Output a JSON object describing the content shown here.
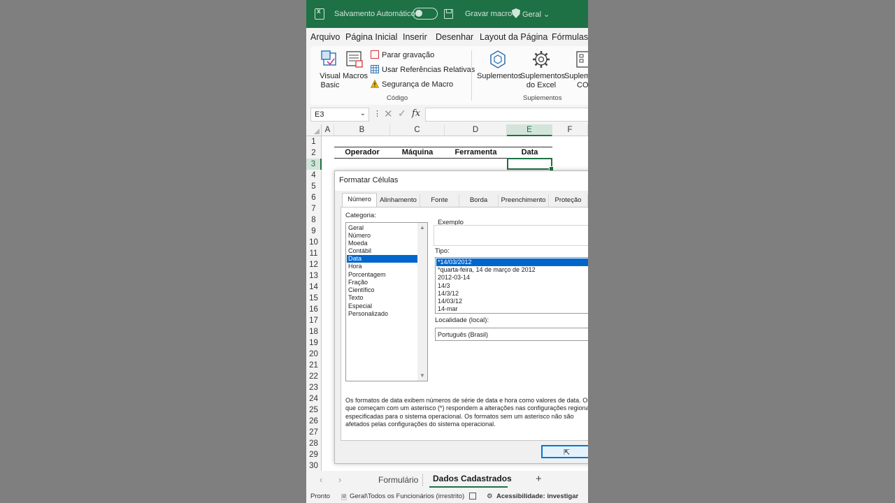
{
  "titlebar": {
    "autosave_label": "Salvamento Automático",
    "record_macro": "Gravar macro",
    "sensitivity": "Geral"
  },
  "ribbon_tabs": [
    "Arquivo",
    "Página Inicial",
    "Inserir",
    "Desenhar",
    "Layout da Página",
    "Fórmulas"
  ],
  "ribbon": {
    "visual_basic_1": "Visual",
    "visual_basic_2": "Basic",
    "macros": "Macros",
    "stop_recording": "Parar gravação",
    "relative_refs": "Usar Referências Relativas",
    "macro_security": "Segurança de Macro",
    "group_code": "Código",
    "addins": "Suplementos",
    "excel_addins_1": "Suplementos",
    "excel_addins_2": "do Excel",
    "com_addins_1": "Suplemen",
    "com_addins_2": "COM",
    "group_addins": "Suplementos"
  },
  "formula_bar": {
    "name_box": "E3",
    "fx": "fx",
    "value": ""
  },
  "columns": [
    "A",
    "B",
    "C",
    "D",
    "E",
    "F"
  ],
  "selected_column": "E",
  "rows": [
    "1",
    "2",
    "3",
    "4",
    "5",
    "6",
    "7",
    "8",
    "9",
    "10",
    "11",
    "12",
    "13",
    "14",
    "15",
    "16",
    "17",
    "18",
    "19",
    "20",
    "21",
    "22",
    "23",
    "24",
    "25",
    "26",
    "27",
    "28",
    "29",
    "30"
  ],
  "selected_row": "3",
  "table_headers": [
    "Operador",
    "Máquina",
    "Ferramenta",
    "Data"
  ],
  "dialog": {
    "title": "Formatar Células",
    "tabs": [
      "Número",
      "Alinhamento",
      "Fonte",
      "Borda",
      "Preenchimento",
      "Proteção"
    ],
    "active_tab": "Número",
    "category_label": "Categoria:",
    "categories": [
      "Geral",
      "Número",
      "Moeda",
      "Contábil",
      "Data",
      "Hora",
      "Porcentagem",
      "Fração",
      "Científico",
      "Texto",
      "Especial",
      "Personalizado"
    ],
    "selected_category": "Data",
    "example_label": "Exemplo",
    "type_label": "Tipo:",
    "types": [
      "*14/03/2012",
      "*quarta-feira, 14 de março de 2012",
      "2012-03-14",
      "14/3",
      "14/3/12",
      "14/03/12",
      "14-mar"
    ],
    "selected_type": "*14/03/2012",
    "locale_label": "Localidade (local):",
    "locale_value": "Português (Brasil)",
    "description": "Os formatos de data exibem números de série de data e hora como valores de data. Os que começam com um asterisco (*) respondem a alterações nas configurações regionais especificadas para o sistema operacional. Os formatos sem um asterisco não são afetados pelas configurações do sistema operacional."
  },
  "sheets": {
    "tabs": [
      "Formulário",
      "Dados Cadastrados"
    ],
    "active": "Dados Cadastrados",
    "add": "+"
  },
  "status": {
    "ready": "Pronto",
    "sensitivity": "Geral\\Todos os Funcionários (irrestrito)",
    "accessibility": "Acessibilidade: investigar"
  },
  "colors": {
    "excel_green": "#1e7145",
    "selection_blue": "#0066cc"
  }
}
